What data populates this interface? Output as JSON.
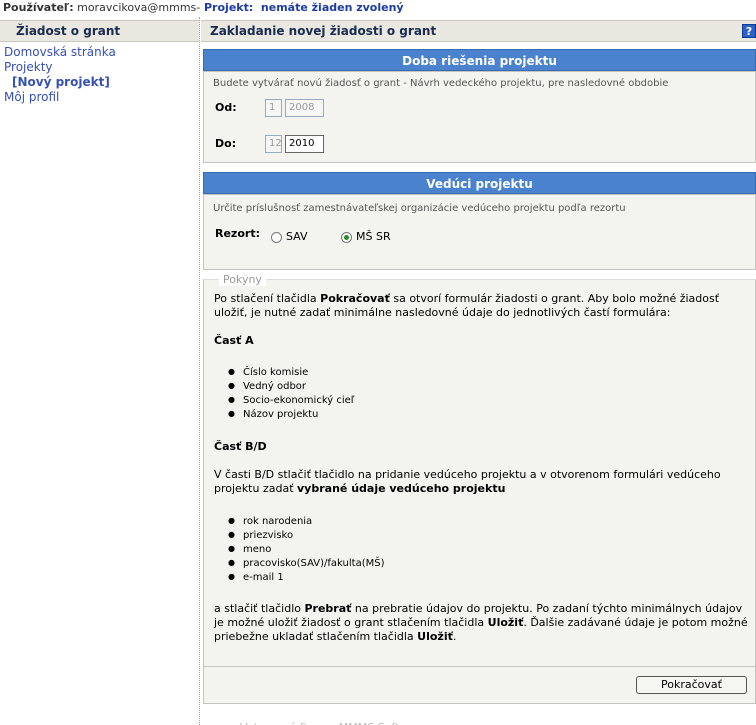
{
  "topbar": {
    "user_label": "Používateľ:",
    "user_value": "moravcikova@mmms-softec",
    "project_label": "Projekt:",
    "project_value": "nemáte žiaden zvolený"
  },
  "sidebar": {
    "title": "Žiadost o grant",
    "items": [
      {
        "label": "Domovská stránka"
      },
      {
        "label": "Projekty"
      },
      {
        "label": "[Nový projekt]"
      },
      {
        "label": "Môj profil"
      }
    ]
  },
  "main": {
    "title": "Zakladanie novej žiadosti o grant",
    "help_label": "?"
  },
  "period": {
    "heading": "Doba riešenia projektu",
    "description": "Budete vytvárať novú žiadosť o grant - Návrh vedeckého projektu, pre nasledovné obdobie",
    "from_label": "Od:",
    "from_month": "1",
    "from_year": "2008",
    "to_label": "Do:",
    "to_month": "12",
    "to_year": "2010"
  },
  "leader": {
    "heading": "Vedúci projektu",
    "description": "Určite príslušnosť zamestnávateľskej organizácie vedúceho projektu podľa rezortu",
    "rezort_label": "Rezort:",
    "options": [
      {
        "label": "SAV",
        "selected": false
      },
      {
        "label": "MŠ SR",
        "selected": true
      }
    ]
  },
  "instructions": {
    "legend": "Pokyny",
    "intro_a": "Po stlačení tlačidla ",
    "intro_b": "Pokračovať",
    "intro_c": " sa otvorí formulár žiadosti o grant. Aby bolo možné žiadosť uložiť, je nutné zadať minimálne nasledovné údaje do jednotlivých častí formulára:",
    "part_a_title": "Časť A",
    "part_a_items": [
      "Číslo komisie",
      "Vedný odbor",
      "Socio-ekonomický cieľ",
      "Názov projektu"
    ],
    "part_bd_title": "Časť B/D",
    "part_bd_text_a": "V časti B/D stlačiť tlačidlo na pridanie vedúceho projektu a v otvorenom formulári vedúceho projektu zadať ",
    "part_bd_text_b": "vybrané údaje vedúceho projektu",
    "part_bd_items": [
      "rok narodenia",
      "priezvisko",
      "meno",
      "pracovisko(SAV)/fakulta(MŠ)",
      "e-mail 1"
    ],
    "outro_a": "a stlačiť tlačidlo ",
    "outro_b": "Prebrať",
    "outro_c": " na prebratie údajov do projektu. Po zadaní týchto minimálnych údajov je možné uložiť žiadosť o grant stlačením tlačidla ",
    "outro_d": "Uložiť",
    "outro_e": ". Ďalšie zadávané údaje je potom možné priebežne ukladať stlačením tlačidla ",
    "outro_f": "Uložiť",
    "outro_g": "."
  },
  "actions": {
    "continue_label": "Pokračovať"
  },
  "footer": {
    "text": "Vytvorené firmou MMMS Softec s.r.o."
  }
}
